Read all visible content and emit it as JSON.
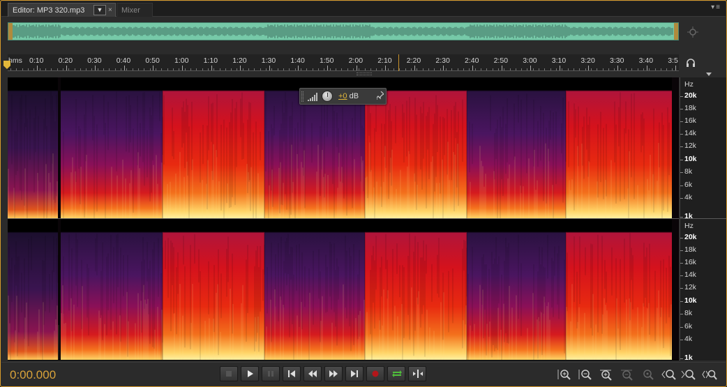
{
  "editor": {
    "tab_label": "Editor: MP3 320.mp3",
    "close_glyph": "×",
    "dropdown_glyph": "▼",
    "mixer_tab_label": "Mixer",
    "panel_menu_glyph": "▾≡"
  },
  "ruler": {
    "format_label": "hms",
    "ticks": [
      "0:10",
      "0:20",
      "0:30",
      "0:40",
      "0:50",
      "1:00",
      "1:10",
      "1:20",
      "1:30",
      "1:40",
      "1:50",
      "2:00",
      "2:10",
      "2:20",
      "2:30",
      "2:40",
      "2:50",
      "3:00",
      "3:10",
      "3:20",
      "3:30",
      "3:40",
      "3:5"
    ]
  },
  "frequency_scale": {
    "unit": "Hz",
    "labels": [
      "20k",
      "18k",
      "16k",
      "14k",
      "12k",
      "10k",
      "8k",
      "6k",
      "4k",
      "1k"
    ]
  },
  "hud": {
    "amount": "+0",
    "unit": " dB"
  },
  "transport": {
    "timecode": "0:00.000"
  },
  "colors": {
    "accent": "#d9a33a",
    "overview_wave": "#76c9a8",
    "spectral_hot": "#ffd36a",
    "spectral_mid": "#e2241c",
    "spectral_cold": "#2a1240"
  },
  "icons": {
    "zoom_navigator": "zoom-navigator-icon",
    "headphones": "headphones-icon",
    "pin": "pin-icon",
    "stop": "stop-icon",
    "play": "play-icon",
    "pause": "pause-icon",
    "skip_prev": "skip-previous-icon",
    "rewind": "rewind-icon",
    "fast_forward": "fast-forward-icon",
    "skip_next": "skip-next-icon",
    "record": "record-icon",
    "loop": "loop-icon",
    "skip_selection": "skip-selection-icon"
  }
}
